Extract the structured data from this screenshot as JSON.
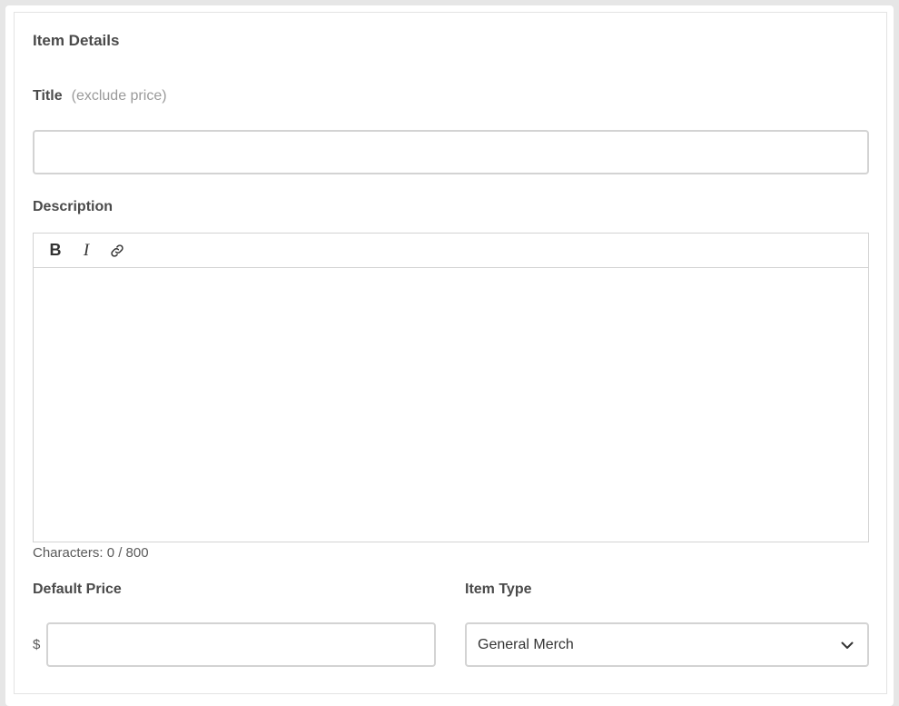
{
  "item_details": {
    "title": "Item Details",
    "title_field": {
      "label": "Title",
      "hint": "(exclude price)",
      "value": ""
    },
    "description_field": {
      "label": "Description",
      "toolbar": {
        "bold_label": "B",
        "italic_label": "I"
      },
      "char_count": "Characters: 0 / 800"
    },
    "default_price_field": {
      "label": "Default Price",
      "currency_symbol": "$",
      "value": ""
    },
    "item_type_field": {
      "label": "Item Type",
      "selected": "General Merch"
    }
  },
  "icons": {
    "link": "link-icon",
    "dropdown": "chevron-down-icon"
  }
}
